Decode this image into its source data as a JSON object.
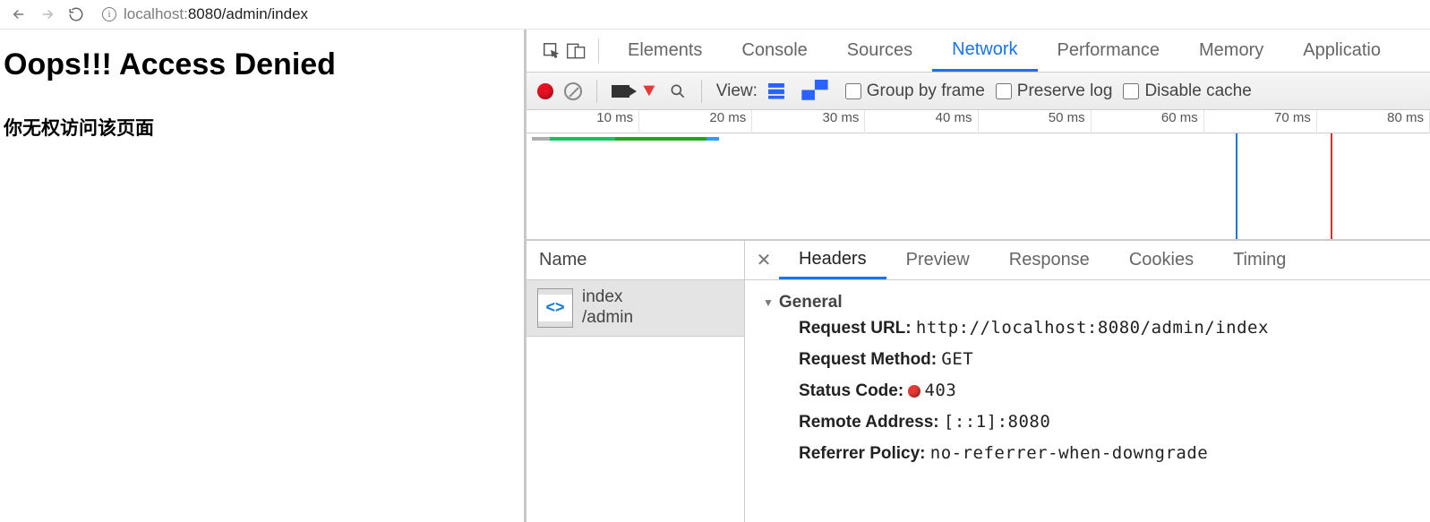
{
  "browser": {
    "url_host": "localhost:",
    "url_port_path": "8080/admin/index"
  },
  "page": {
    "heading": "Oops!!! Access Denied",
    "subheading": "你无权访问该页面"
  },
  "devtools": {
    "tabs": [
      "Elements",
      "Console",
      "Sources",
      "Network",
      "Performance",
      "Memory",
      "Applicatio"
    ],
    "active_tab": "Network",
    "network_toolbar": {
      "view_label": "View:",
      "group_label": "Group by frame",
      "preserve_label": "Preserve log",
      "disable_cache_label": "Disable cache"
    },
    "timeline": {
      "ticks": [
        "10 ms",
        "20 ms",
        "30 ms",
        "40 ms",
        "50 ms",
        "60 ms",
        "70 ms",
        "80 ms"
      ],
      "markers": [
        {
          "pos_pct": 78.5,
          "color": "#1a73e8"
        },
        {
          "pos_pct": 89.0,
          "color": "#d32f2f"
        }
      ],
      "segments": [
        {
          "left_pct": 0.3,
          "width_pct": 2,
          "color": "#aeaeae"
        },
        {
          "left_pct": 2.3,
          "width_pct": 7.2,
          "color": "#18c061"
        },
        {
          "left_pct": 9.5,
          "width_pct": 10.2,
          "color": "#22a51e"
        },
        {
          "left_pct": 19.7,
          "width_pct": 1.4,
          "color": "#2e9dff"
        }
      ]
    },
    "name_header": "Name",
    "request_item": {
      "name": "index",
      "path": "/admin"
    },
    "detail_tabs": [
      "Headers",
      "Preview",
      "Response",
      "Cookies",
      "Timing"
    ],
    "active_detail_tab": "Headers",
    "general": {
      "title": "General",
      "request_url_label": "Request URL:",
      "request_url_value": "http://localhost:8080/admin/index",
      "method_label": "Request Method:",
      "method_value": "GET",
      "status_label": "Status Code:",
      "status_value": "403",
      "remote_label": "Remote Address:",
      "remote_value": "[::1]:8080",
      "referrer_label": "Referrer Policy:",
      "referrer_value": "no-referrer-when-downgrade"
    }
  }
}
